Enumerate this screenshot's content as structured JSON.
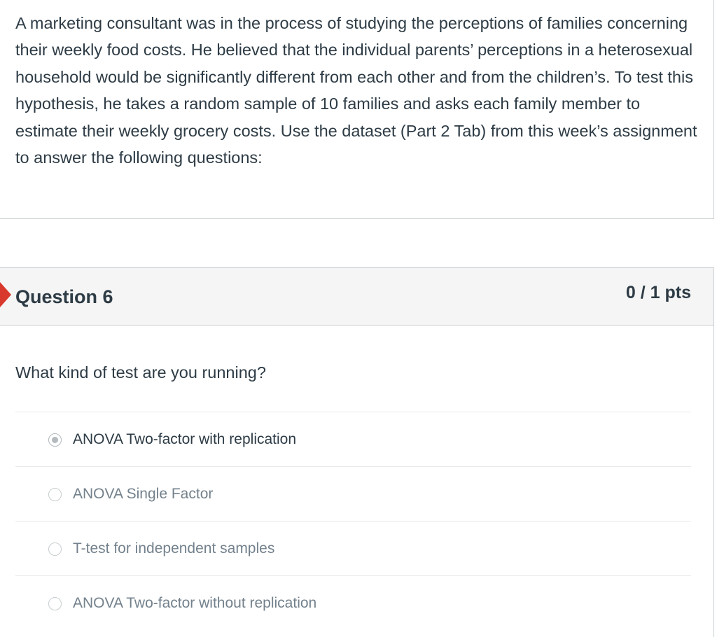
{
  "passage": {
    "text": "A marketing consultant was in the process of studying the perceptions of families concerning their weekly food costs.  He believed that the individual parents’ perceptions in a heterosexual household would be significantly different from each other and from the children’s.  To test this hypothesis, he takes a random sample of 10 families and asks each family member to estimate their weekly grocery costs.  Use the dataset (Part 2 Tab) from this week’s assignment to answer the following questions:"
  },
  "question": {
    "title": "Question 6",
    "points": "0 / 1 pts",
    "prompt": "What kind of test are you running?",
    "answers": [
      {
        "label": "ANOVA Two-factor with replication",
        "selected": true
      },
      {
        "label": "ANOVA Single Factor",
        "selected": false
      },
      {
        "label": "T-test for independent samples",
        "selected": false
      },
      {
        "label": "ANOVA Two-factor without replication",
        "selected": false
      }
    ]
  },
  "colors": {
    "text": "#2d3b45",
    "muted_text": "#73818c",
    "incorrect_marker": "#d9382c",
    "header_bg": "#f5f5f5",
    "border": "#c7cdd1"
  }
}
